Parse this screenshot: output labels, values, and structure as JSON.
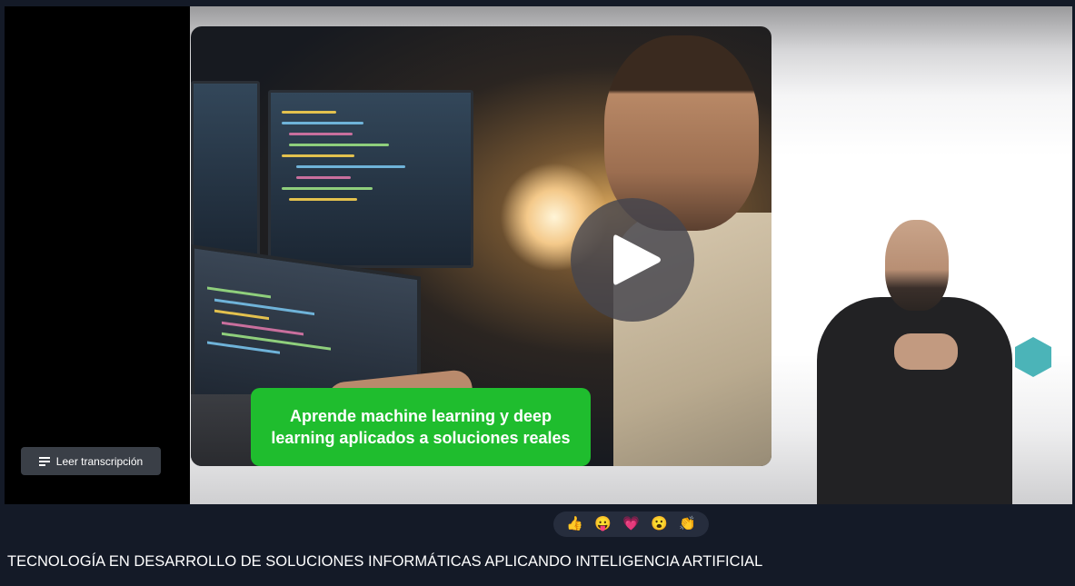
{
  "player": {
    "caption_line1": "Aprende machine learning y deep",
    "caption_line2": "learning aplicados a soluciones reales",
    "transcript_button_label": "Leer transcripción",
    "accent_color": "#1fbd2e"
  },
  "reactions": [
    {
      "icon": "thumbs-up",
      "glyph": "👍"
    },
    {
      "icon": "grinning-face",
      "glyph": "😛"
    },
    {
      "icon": "heart",
      "glyph": "💗"
    },
    {
      "icon": "surprised-face",
      "glyph": "😮"
    },
    {
      "icon": "clapping-hands",
      "glyph": "👏"
    }
  ],
  "video_title": "TECNOLOGÍA EN DESARROLLO DE SOLUCIONES INFORMÁTICAS APLICANDO INTELIGENCIA ARTIFICIAL"
}
